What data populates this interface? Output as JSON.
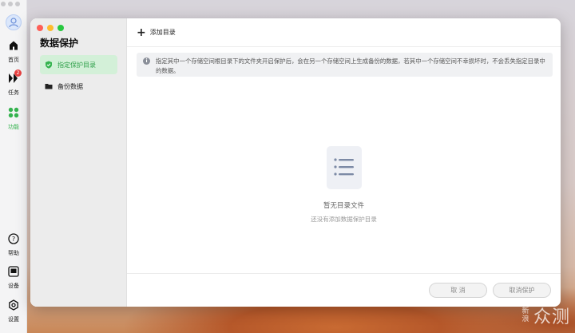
{
  "nav": {
    "items": [
      {
        "label": "首页",
        "icon": "home-icon"
      },
      {
        "label": "任务",
        "icon": "tasks-icon",
        "badge": "2"
      },
      {
        "label": "功能",
        "icon": "grid-icon",
        "active": true
      },
      {
        "label": "帮助",
        "icon": "help-icon"
      },
      {
        "label": "设备",
        "icon": "device-icon"
      },
      {
        "label": "设置",
        "icon": "settings-icon"
      }
    ]
  },
  "sidebar": {
    "title": "数据保护",
    "items": [
      {
        "label": "指定保护目录",
        "icon": "shield-check-icon",
        "active": true
      },
      {
        "label": "备份数据",
        "icon": "folder-icon"
      }
    ]
  },
  "toolbar": {
    "add_label": "添加目录"
  },
  "info": {
    "text": "指定其中一个存储空间根目录下的文件夹开启保护后，会在另一个存储空间上生成备份的数据，若其中一个存储空间不幸损坏时，不会丢失指定目录中的数据。"
  },
  "empty": {
    "title": "暂无目录文件",
    "subtitle": "还没有添加数据保护目录"
  },
  "footer": {
    "cancel_label": "取 消",
    "cancel_protect_label": "取消保护"
  },
  "watermark": {
    "small": "新浪",
    "big": "众测"
  },
  "colors": {
    "accent": "#35b34f",
    "active_bg": "#d3f0d8"
  }
}
